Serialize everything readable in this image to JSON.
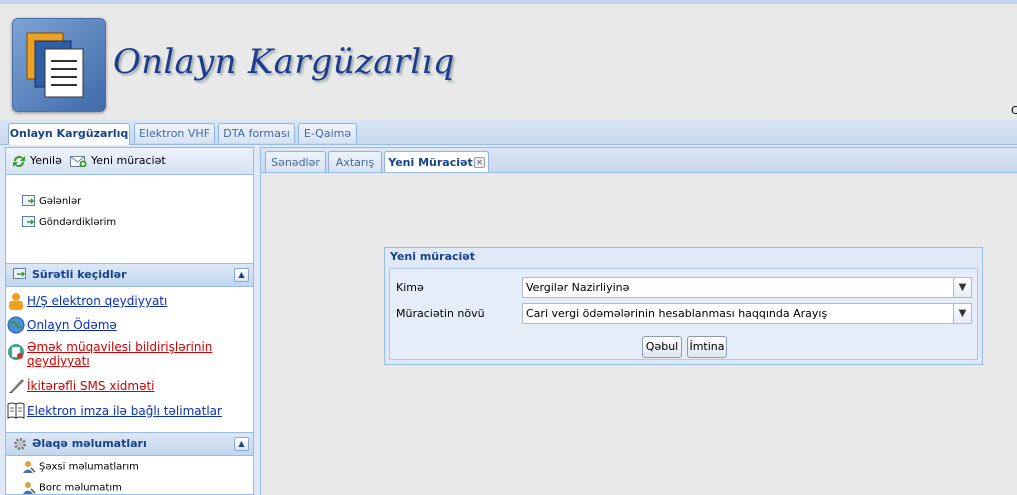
{
  "app": {
    "title": "Onlayn Kargüzarlıq",
    "edge_char": "C"
  },
  "main_tabs": [
    {
      "label": "Onlayn Kargüzarlıq",
      "active": true
    },
    {
      "label": "Elektron VHF",
      "active": false
    },
    {
      "label": "DTA forması",
      "active": false
    },
    {
      "label": "E-Qaimə",
      "active": false
    }
  ],
  "west": {
    "toolbar": {
      "refresh_label": "Yenilə",
      "new_request_label": "Yeni müraciət"
    },
    "tree": [
      {
        "label": "Gələnlər"
      },
      {
        "label": "Göndərdiklərim"
      }
    ],
    "quick_links": {
      "title": "Sürətli keçidlər",
      "items": [
        {
          "label": "H/Ş elektron qeydiyyatı",
          "color": "blue"
        },
        {
          "label": "Onlayn Ödəmə",
          "color": "blue"
        },
        {
          "label_line1": "Əmək müqavilesi bildirişlərinin",
          "label_line2": "qeydiyyatı",
          "color": "red"
        },
        {
          "label": "İkitərəfli SMS xidməti",
          "color": "red"
        },
        {
          "label": "Elektron imza ilə bağlı təlimatlar",
          "color": "blue"
        }
      ]
    },
    "contact": {
      "title": "Əlaqə məlumatları",
      "items": [
        {
          "label": "Şəxsi məlumatlarım"
        },
        {
          "label": "Borc məlumatım"
        }
      ]
    }
  },
  "center_tabs": [
    {
      "label": "Sənədlər",
      "active": false
    },
    {
      "label": "Axtarış",
      "active": false
    },
    {
      "label": "Yeni Müraciət",
      "active": true
    }
  ],
  "form": {
    "title": "Yeni müraciət",
    "fields": {
      "recipient": {
        "label": "Kimə",
        "value": "Vergilər Nazirliyinə"
      },
      "request_type": {
        "label": "Müraciətin növü",
        "value": "Cari vergi ödəmələrinin hesablanması haqqında Arayış"
      }
    },
    "accept_label": "Qəbul",
    "cancel_label": "İmtina"
  },
  "colors": {
    "link_blue": "#0b2fb4",
    "link_red": "#cc0000",
    "panel_border": "#99bbe8",
    "title_blue": "#1f3c8c"
  }
}
